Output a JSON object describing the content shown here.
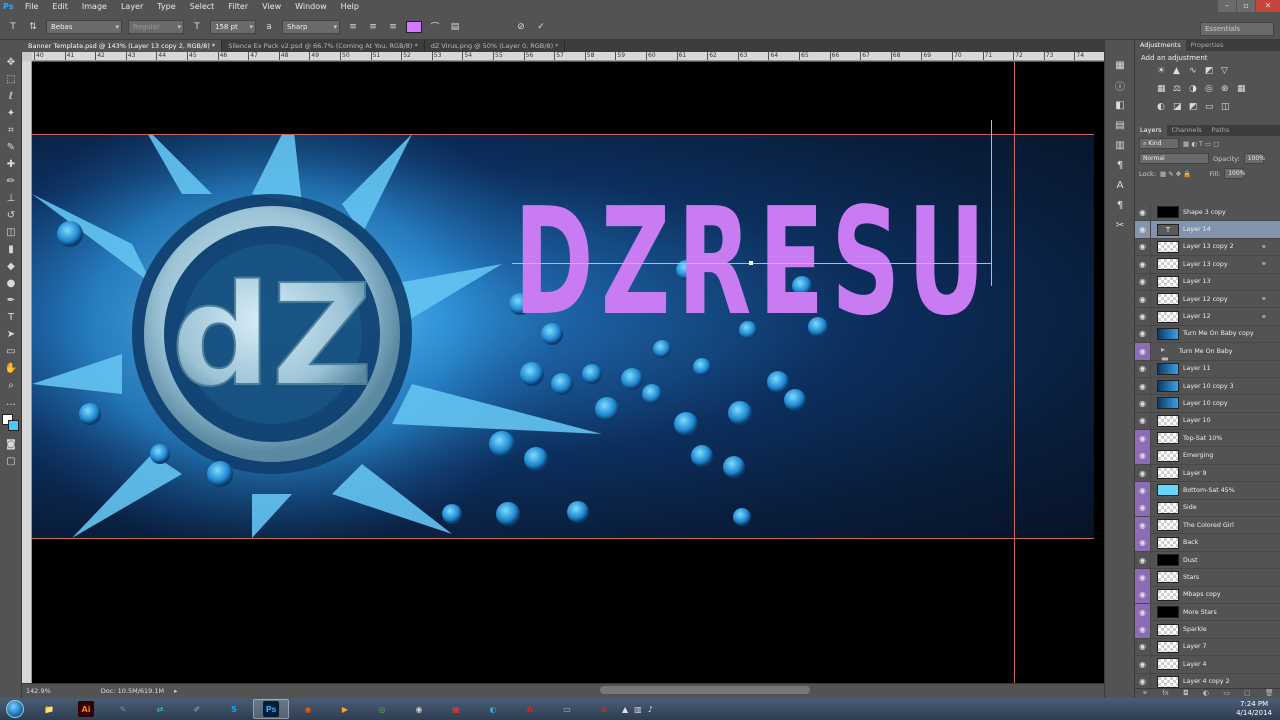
{
  "app": {
    "logo": "Ps",
    "menu": [
      "File",
      "Edit",
      "Image",
      "Layer",
      "Type",
      "Select",
      "Filter",
      "View",
      "Window",
      "Help"
    ]
  },
  "options_bar": {
    "font_family": "Bebas",
    "font_style": "Regular",
    "font_size": "158 pt",
    "antialias": "Sharp",
    "text_color": "#c97cf2",
    "workspace": "Essentials"
  },
  "tabs": [
    {
      "label": "Banner Template.psd @ 143% (Layer 13 copy 2, RGB/8) *",
      "active": true
    },
    {
      "label": "Silence Ex Pack v2.psd @ 66.7% (Coming At You, RGB/8) *",
      "active": false
    },
    {
      "label": "dZ Virus.png @ 50% (Layer 0, RGB/8) *",
      "active": false
    }
  ],
  "ruler_top": [
    "40",
    "41",
    "42",
    "43",
    "44",
    "45",
    "46",
    "47",
    "48",
    "49",
    "50",
    "51",
    "52",
    "53",
    "54",
    "55",
    "56",
    "57",
    "58",
    "59",
    "60",
    "61",
    "62",
    "63",
    "64",
    "65",
    "66",
    "67",
    "68",
    "69",
    "70",
    "71",
    "72",
    "73",
    "74"
  ],
  "canvas": {
    "headline": "DZRESU",
    "headline_color": "#c97cf2"
  },
  "panels": {
    "top_tabs": [
      "Adjustments",
      "Properties"
    ],
    "adjust_title": "Add an adjustment",
    "layer_tabs": [
      "Layers",
      "Channels",
      "Paths"
    ],
    "kind": "Kind",
    "blend_mode": "Normal",
    "opacity_label": "Opacity:",
    "opacity": "100%",
    "lock_label": "Lock:",
    "fill_label": "Fill:",
    "fill": "100%",
    "layers": [
      {
        "name": "Shape 3 copy",
        "thumb": "black",
        "purple": false,
        "link": false
      },
      {
        "name": "Layer 14",
        "thumb": "text",
        "purple": false,
        "link": false,
        "selected": true
      },
      {
        "name": "Layer 13 copy 2",
        "thumb": "checker",
        "purple": false,
        "link": true
      },
      {
        "name": "Layer 13 copy",
        "thumb": "checker",
        "purple": false,
        "link": true
      },
      {
        "name": "Layer 13",
        "thumb": "checker",
        "purple": false,
        "link": false
      },
      {
        "name": "Layer 12 copy",
        "thumb": "checker",
        "purple": false,
        "link": true
      },
      {
        "name": "Layer 12",
        "thumb": "checker",
        "purple": false,
        "link": true
      },
      {
        "name": "Turn Me On Baby copy",
        "thumb": "blue",
        "purple": false,
        "link": false
      },
      {
        "name": "Turn Me On Baby",
        "thumb": "folder",
        "purple": true,
        "link": false
      },
      {
        "name": "Layer 11",
        "thumb": "blue",
        "purple": false,
        "link": false
      },
      {
        "name": "Layer 10 copy 3",
        "thumb": "blue",
        "purple": false,
        "link": false
      },
      {
        "name": "Layer 10 copy",
        "thumb": "blue",
        "purple": false,
        "link": false
      },
      {
        "name": "Layer 10",
        "thumb": "checker",
        "purple": false,
        "link": false
      },
      {
        "name": "Top-Sat 10%",
        "thumb": "checker",
        "purple": true,
        "link": false
      },
      {
        "name": "Emerging",
        "thumb": "checker",
        "purple": true,
        "link": false
      },
      {
        "name": "Layer 9",
        "thumb": "checker",
        "purple": false,
        "link": false
      },
      {
        "name": "Bottom-Sat 45%",
        "thumb": "cyan",
        "purple": true,
        "link": false
      },
      {
        "name": "Side",
        "thumb": "checker",
        "purple": true,
        "link": false
      },
      {
        "name": "The Colored Girl",
        "thumb": "checker",
        "purple": true,
        "link": false
      },
      {
        "name": "Back",
        "thumb": "checker",
        "purple": true,
        "link": false
      },
      {
        "name": "Dust",
        "thumb": "black",
        "purple": false,
        "link": false
      },
      {
        "name": "Stars",
        "thumb": "checker",
        "purple": true,
        "link": false
      },
      {
        "name": "Mbaps copy",
        "thumb": "checker",
        "purple": true,
        "link": false
      },
      {
        "name": "More Stars",
        "thumb": "black",
        "purple": true,
        "link": false
      },
      {
        "name": "Sparkle",
        "thumb": "checker",
        "purple": true,
        "link": false
      },
      {
        "name": "Layer 7",
        "thumb": "checker",
        "purple": false,
        "link": false
      },
      {
        "name": "Layer 4",
        "thumb": "checker",
        "purple": false,
        "link": false
      },
      {
        "name": "Layer 4 copy 2",
        "thumb": "checker",
        "purple": false,
        "link": false
      }
    ]
  },
  "status": {
    "zoom": "142.9%",
    "doc": "Doc: 10.5M/619.1M"
  },
  "taskbar": {
    "time": "7:24 PM",
    "date": "4/14/2014",
    "apps": [
      {
        "icon": "explorer-icon",
        "glyph": "📁",
        "color": "#d8b04a"
      },
      {
        "icon": "illustrator-icon",
        "glyph": "Ai",
        "color": "#ff7c00"
      },
      {
        "icon": "paint-icon",
        "glyph": "✎",
        "color": "#69a"
      },
      {
        "icon": "network-icon",
        "glyph": "⇄",
        "color": "#4a8"
      },
      {
        "icon": "brush-icon",
        "glyph": "✐",
        "color": "#aaa"
      },
      {
        "icon": "skype-icon",
        "glyph": "S",
        "color": "#00aff0"
      },
      {
        "icon": "photoshop-icon",
        "glyph": "Ps",
        "color": "#31a8ff"
      },
      {
        "icon": "firefox-icon",
        "glyph": "◉",
        "color": "#e66000"
      },
      {
        "icon": "media-player-icon",
        "glyph": "▶",
        "color": "#f5a623"
      },
      {
        "icon": "chrome-icon",
        "glyph": "◎",
        "color": "#4caf50"
      },
      {
        "icon": "eye-app-icon",
        "glyph": "◉",
        "color": "#ccc"
      },
      {
        "icon": "popcorn-icon",
        "glyph": "▦",
        "color": "#e33"
      },
      {
        "icon": "app-circle-icon",
        "glyph": "◐",
        "color": "#3ac"
      },
      {
        "icon": "acrobat-icon",
        "glyph": "A",
        "color": "#d22"
      },
      {
        "icon": "window-icon",
        "glyph": "▭",
        "color": "#bbb"
      },
      {
        "icon": "creative-cloud-icon",
        "glyph": "⊛",
        "color": "#d22"
      }
    ]
  }
}
